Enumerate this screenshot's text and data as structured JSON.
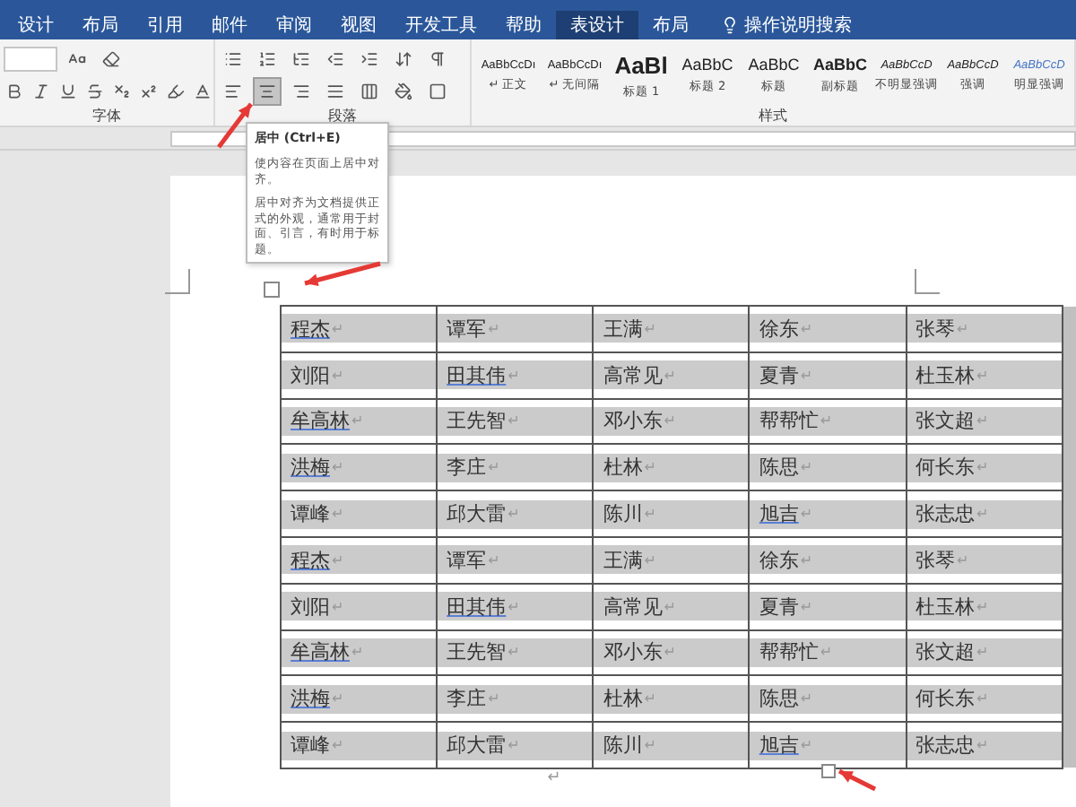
{
  "tabs": [
    {
      "label": "设计",
      "selected": false
    },
    {
      "label": "布局",
      "selected": false
    },
    {
      "label": "引用",
      "selected": false
    },
    {
      "label": "邮件",
      "selected": false
    },
    {
      "label": "审阅",
      "selected": false
    },
    {
      "label": "视图",
      "selected": false
    },
    {
      "label": "开发工具",
      "selected": false
    },
    {
      "label": "帮助",
      "selected": false
    },
    {
      "label": "表设计",
      "selected": true
    },
    {
      "label": "布局",
      "selected": false
    }
  ],
  "search": {
    "placeholder": "操作说明搜索"
  },
  "ribbon": {
    "font_group": "字体",
    "paragraph_group": "段落",
    "styles_group": "样式",
    "alignment": [
      {
        "selected": false
      },
      {
        "selected": true
      },
      {
        "selected": false
      },
      {
        "selected": false
      },
      {
        "selected": false
      }
    ],
    "styles": [
      {
        "preview": "AaBbCcDı",
        "name": "↵ 正文",
        "kind": "normal"
      },
      {
        "preview": "AaBbCcDı",
        "name": "↵ 无间隔",
        "kind": "normal"
      },
      {
        "preview": "AaBl",
        "name": "标题 1",
        "kind": "heading1"
      },
      {
        "preview": "AaBbC",
        "name": "标题 2",
        "kind": "heading2"
      },
      {
        "preview": "AaBbC",
        "name": "标题",
        "kind": "heading2"
      },
      {
        "preview": "AaBbC",
        "name": "副标题",
        "kind": "bold"
      },
      {
        "preview": "AaBbCcD",
        "name": "不明显强调",
        "kind": "italic"
      },
      {
        "preview": "AaBbCcD",
        "name": "强调",
        "kind": "italic"
      },
      {
        "preview": "AaBbCcD",
        "name": "明显强调",
        "kind": "accent"
      }
    ]
  },
  "tooltip": {
    "title": "居中 (Ctrl+E)",
    "lines": [
      "使内容在页面上居中对齐。",
      "居中对齐为文档提供正式的外观，通常用于封面、引言，有时用于标题。"
    ]
  },
  "table": {
    "mark": "↵",
    "rows": [
      [
        {
          "text": "程杰",
          "flagged": true
        },
        {
          "text": "谭军",
          "flagged": false
        },
        {
          "text": "王满",
          "flagged": false
        },
        {
          "text": "徐东",
          "flagged": false
        },
        {
          "text": "张琴",
          "flagged": false
        }
      ],
      [
        {
          "text": "刘阳",
          "flagged": false
        },
        {
          "text": "田其伟",
          "flagged": true
        },
        {
          "text": "高常见",
          "flagged": false
        },
        {
          "text": "夏青",
          "flagged": false
        },
        {
          "text": "杜玉林",
          "flagged": false
        }
      ],
      [
        {
          "text": "牟高林",
          "flagged": true
        },
        {
          "text": "王先智",
          "flagged": false
        },
        {
          "text": "邓小东",
          "flagged": false
        },
        {
          "text": "帮帮忙",
          "flagged": false
        },
        {
          "text": "张文超",
          "flagged": false
        }
      ],
      [
        {
          "text": "洪梅",
          "flagged": true
        },
        {
          "text": "李庄",
          "flagged": false
        },
        {
          "text": "杜林",
          "flagged": false
        },
        {
          "text": "陈思",
          "flagged": false
        },
        {
          "text": "何长东",
          "flagged": false
        }
      ],
      [
        {
          "text": "谭峰",
          "flagged": false
        },
        {
          "text": "邱大雷",
          "flagged": false
        },
        {
          "text": "陈川",
          "flagged": false
        },
        {
          "text": "旭吉",
          "flagged": true
        },
        {
          "text": "张志忠",
          "flagged": false
        }
      ],
      [
        {
          "text": "程杰",
          "flagged": true
        },
        {
          "text": "谭军",
          "flagged": false
        },
        {
          "text": "王满",
          "flagged": false
        },
        {
          "text": "徐东",
          "flagged": false
        },
        {
          "text": "张琴",
          "flagged": false
        }
      ],
      [
        {
          "text": "刘阳",
          "flagged": false
        },
        {
          "text": "田其伟",
          "flagged": true
        },
        {
          "text": "高常见",
          "flagged": false
        },
        {
          "text": "夏青",
          "flagged": false
        },
        {
          "text": "杜玉林",
          "flagged": false
        }
      ],
      [
        {
          "text": "牟高林",
          "flagged": true
        },
        {
          "text": "王先智",
          "flagged": false
        },
        {
          "text": "邓小东",
          "flagged": false
        },
        {
          "text": "帮帮忙",
          "flagged": false
        },
        {
          "text": "张文超",
          "flagged": false
        }
      ],
      [
        {
          "text": "洪梅",
          "flagged": true
        },
        {
          "text": "李庄",
          "flagged": false
        },
        {
          "text": "杜林",
          "flagged": false
        },
        {
          "text": "陈思",
          "flagged": false
        },
        {
          "text": "何长东",
          "flagged": false
        }
      ],
      [
        {
          "text": "谭峰",
          "flagged": false
        },
        {
          "text": "邱大雷",
          "flagged": false
        },
        {
          "text": "陈川",
          "flagged": false
        },
        {
          "text": "旭吉",
          "flagged": true
        },
        {
          "text": "张志忠",
          "flagged": false
        }
      ]
    ]
  },
  "after_table_mark": "↵"
}
